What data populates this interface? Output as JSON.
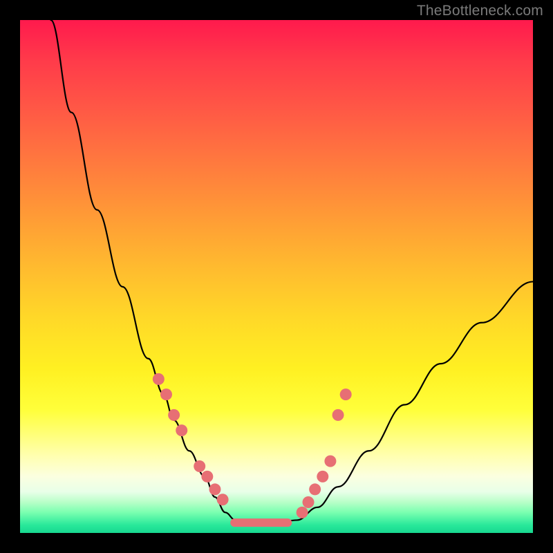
{
  "watermark": "TheBottleneck.com",
  "colors": {
    "curve_stroke": "#000000",
    "dot_fill": "#e76f74",
    "flat_band_fill": "#e76f74"
  },
  "chart_data": {
    "type": "line",
    "title": "",
    "xlabel": "",
    "ylabel": "",
    "xlim": [
      0,
      100
    ],
    "ylim": [
      0,
      100
    ],
    "series": [
      {
        "name": "v-curve",
        "x": [
          6,
          10,
          15,
          20,
          25,
          28,
          30,
          33,
          36,
          38,
          40,
          42,
          44,
          46,
          50,
          54,
          58,
          62,
          68,
          75,
          82,
          90,
          100
        ],
        "y": [
          100,
          82,
          63,
          48,
          34,
          27,
          22,
          16,
          11,
          7,
          4,
          2.5,
          2,
          2,
          2,
          2.5,
          5,
          9,
          16,
          25,
          33,
          41,
          49
        ]
      }
    ],
    "markers": [
      {
        "name": "left-dots",
        "x": [
          27,
          28.5,
          30,
          31.5,
          35,
          36.5,
          38,
          39.5
        ],
        "y": [
          30,
          27,
          23,
          20,
          13,
          11,
          8.5,
          6.5
        ]
      },
      {
        "name": "right-dots",
        "x": [
          55,
          56.2,
          57.5,
          59,
          60.5,
          62,
          63.5
        ],
        "y": [
          4,
          6,
          8.5,
          11,
          14,
          23,
          27
        ]
      }
    ],
    "flat_band": {
      "x0": 41,
      "x1": 53,
      "y": 2
    }
  }
}
